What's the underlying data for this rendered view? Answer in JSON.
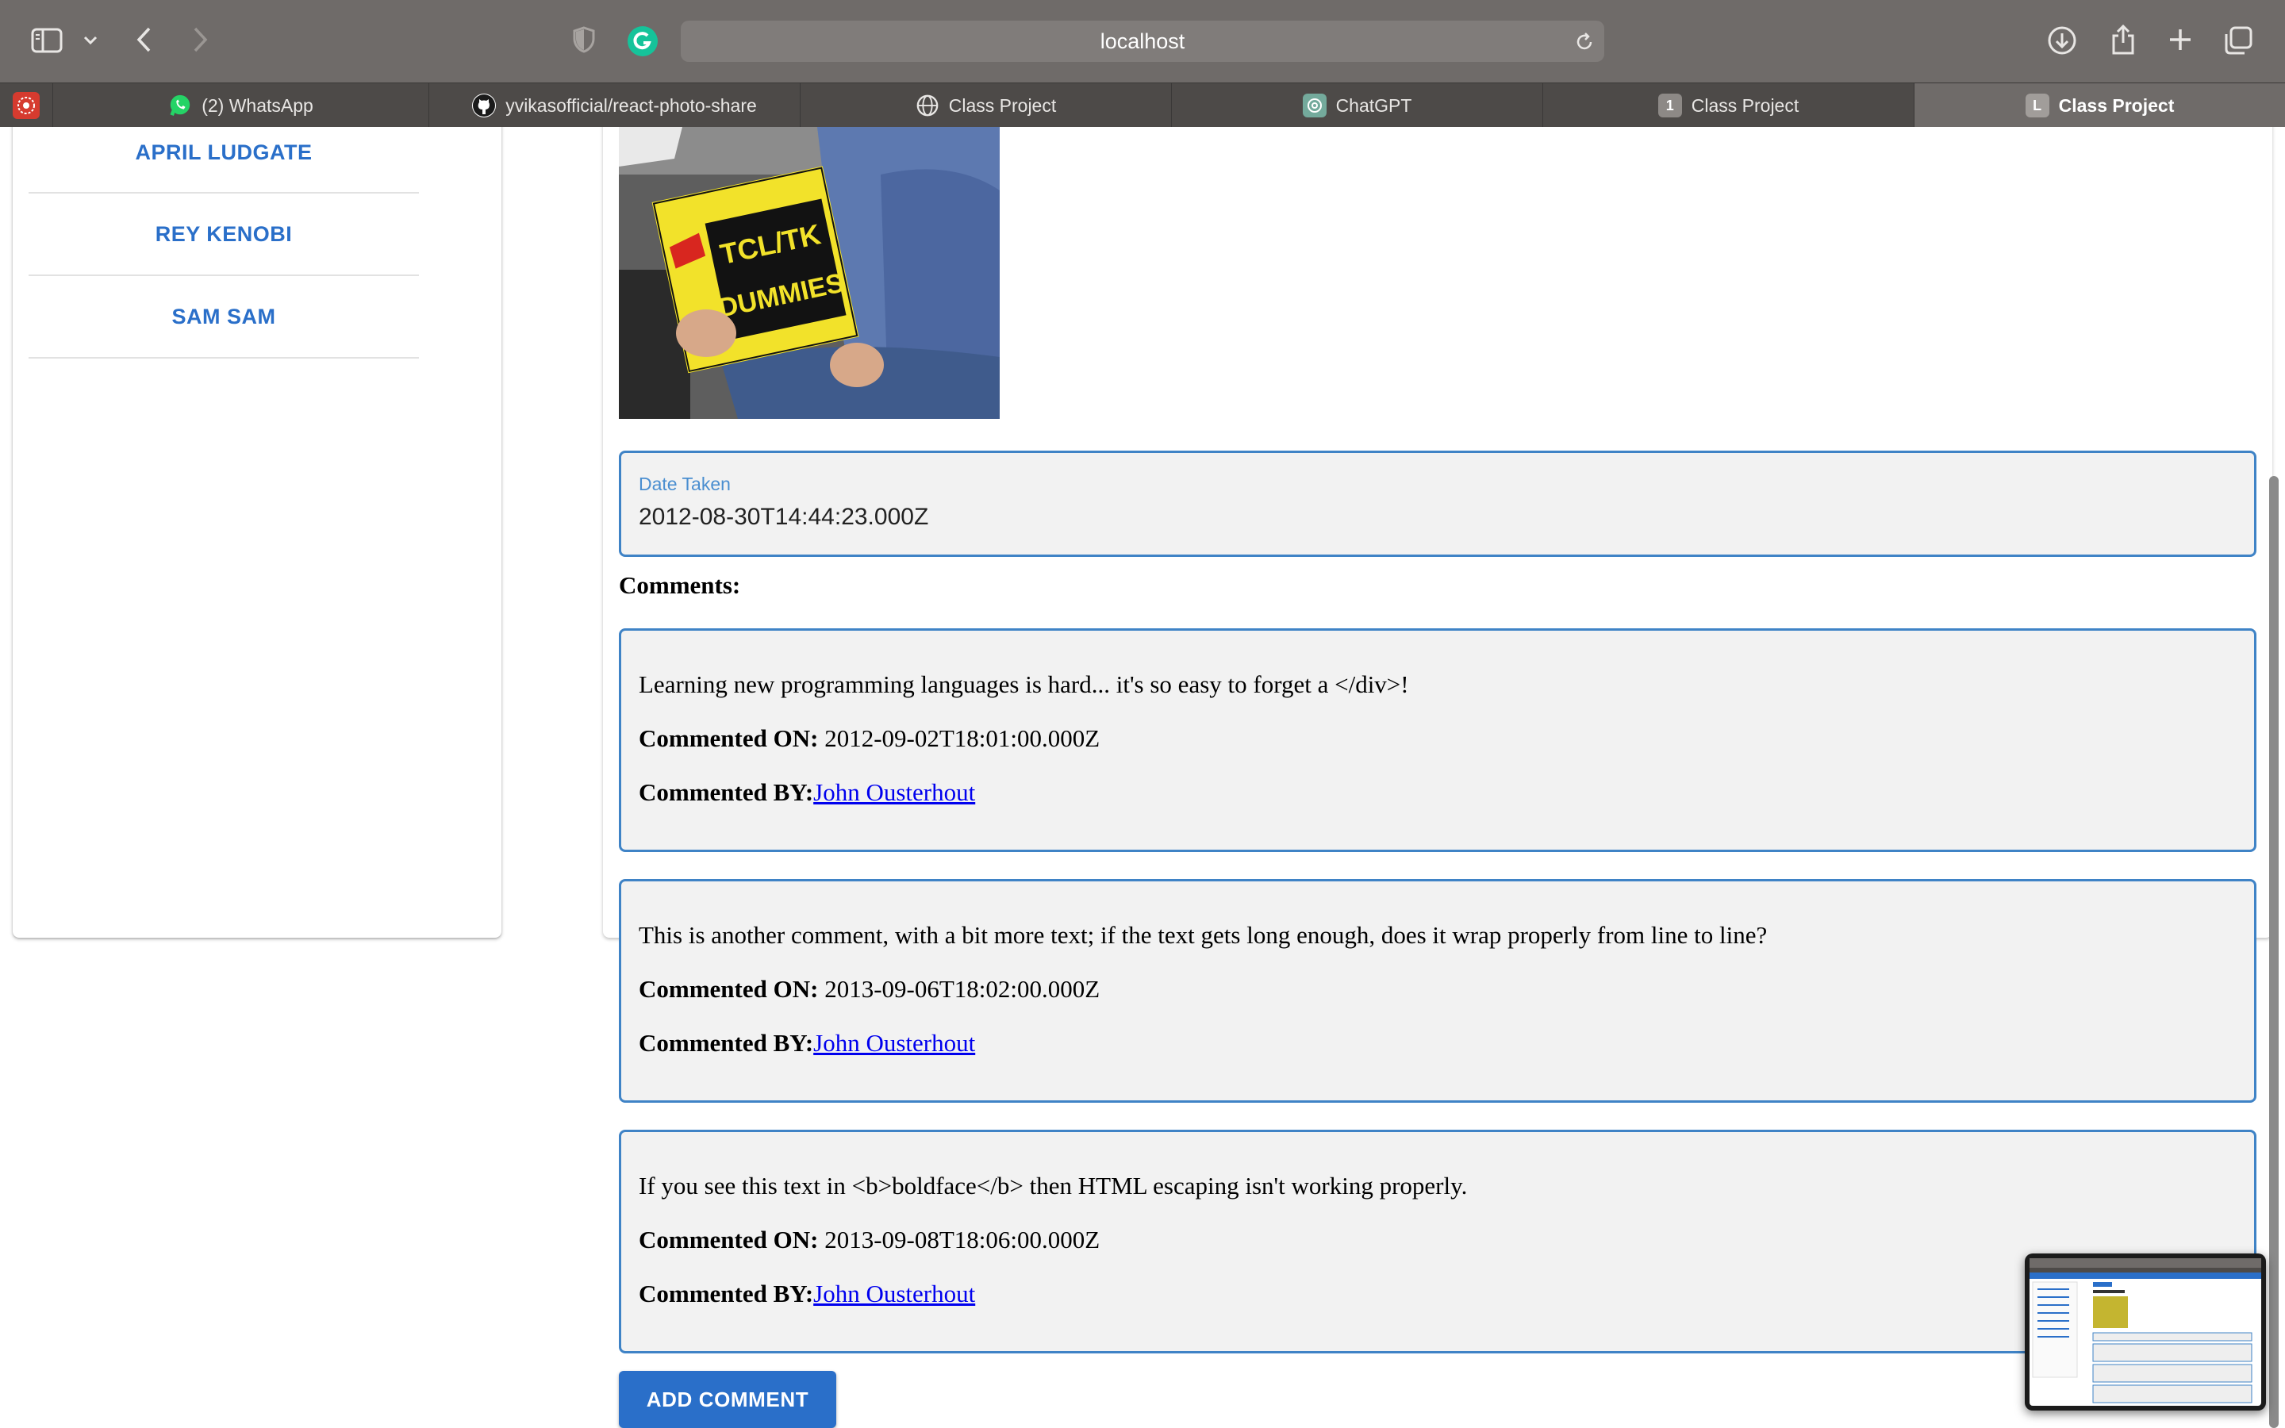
{
  "browser": {
    "url": "localhost",
    "tabs": [
      {
        "label": "",
        "icon": "app-icon"
      },
      {
        "label": "(2) WhatsApp",
        "icon": "whatsapp-icon"
      },
      {
        "label": "yvikasofficial/react-photo-share",
        "icon": "github-icon"
      },
      {
        "label": "Class Project",
        "icon": "globe-icon"
      },
      {
        "label": "ChatGPT",
        "icon": "chatgpt-icon"
      },
      {
        "label": "Class Project",
        "icon": "numbered-favicon",
        "badge": "1"
      },
      {
        "label": "Class Project",
        "icon": "letter-favicon",
        "badge": "L"
      }
    ]
  },
  "sidebar": {
    "users": [
      "APRIL LUDGATE",
      "REY KENOBI",
      "SAM SAM"
    ]
  },
  "photo": {
    "book_title_line1": "TCL/TK",
    "book_title_line2": "DUMMIES"
  },
  "date_field": {
    "label": "Date Taken",
    "value": "2012-08-30T14:44:23.000Z"
  },
  "comments_heading": "Comments:",
  "comment_on_label": "Commented ON:",
  "comment_by_label": "Commented BY:",
  "comments": [
    {
      "text": "Learning new programming languages is hard... it's so easy to forget a </div>!",
      "date": "2012-09-02T18:01:00.000Z",
      "author": "John Ousterhout"
    },
    {
      "text": "This is another comment, with a bit more text; if the text gets long enough, does it wrap properly from line to line?",
      "date": "2013-09-06T18:02:00.000Z",
      "author": "John Ousterhout"
    },
    {
      "text": "If you see this text in <b>boldface</b> then HTML escaping isn't working properly.",
      "date": "2013-09-08T18:06:00.000Z",
      "author": "John Ousterhout"
    }
  ],
  "add_comment_label": "ADD COMMENT",
  "colors": {
    "accent": "#2a6fc9",
    "border": "#3f83c6",
    "box_bg": "#f2f2f2",
    "link": "#0000ee"
  }
}
